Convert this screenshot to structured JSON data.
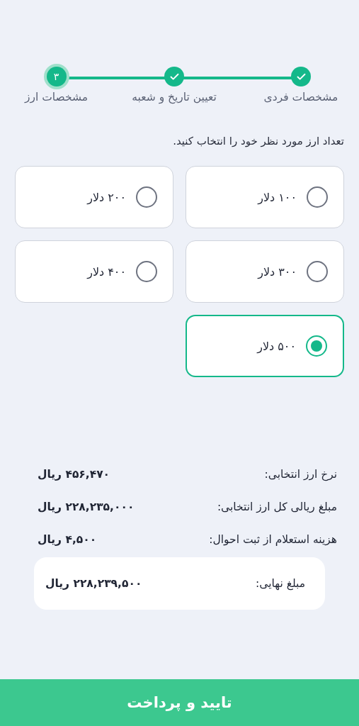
{
  "stepper": {
    "steps": [
      {
        "label": "مشخصات فردی",
        "done": true,
        "selected": false
      },
      {
        "label": "تعیین تاریخ و شعبه",
        "done": true,
        "selected": false
      },
      {
        "label": "مشخصات ارز",
        "done": false,
        "selected": true,
        "number": "۳"
      }
    ]
  },
  "prompt": "تعداد ارز مورد نظر خود را انتخاب کنید.",
  "options": [
    {
      "label": "۱۰۰ دلار",
      "selected": false
    },
    {
      "label": "۲۰۰ دلار",
      "selected": false
    },
    {
      "label": "۳۰۰ دلار",
      "selected": false
    },
    {
      "label": "۴۰۰ دلار",
      "selected": false
    },
    {
      "label": "۵۰۰ دلار",
      "selected": true
    }
  ],
  "summary": [
    {
      "label": "نرخ ارز انتخابی:",
      "value": "۴۵۶,۴۷۰ ریال"
    },
    {
      "label": "مبلغ ریالی کل ارز انتخابی:",
      "value": "۲۲۸,۲۳۵,۰۰۰ ریال"
    },
    {
      "label": "هزینه استعلام از ثبت احوال:",
      "value": "۴,۵۰۰ ریال"
    }
  ],
  "total": {
    "label": "مبلغ نهایی:",
    "value": "۲۲۸,۲۳۹,۵۰۰ ریال"
  },
  "submit_button": "تایید و پرداخت"
}
